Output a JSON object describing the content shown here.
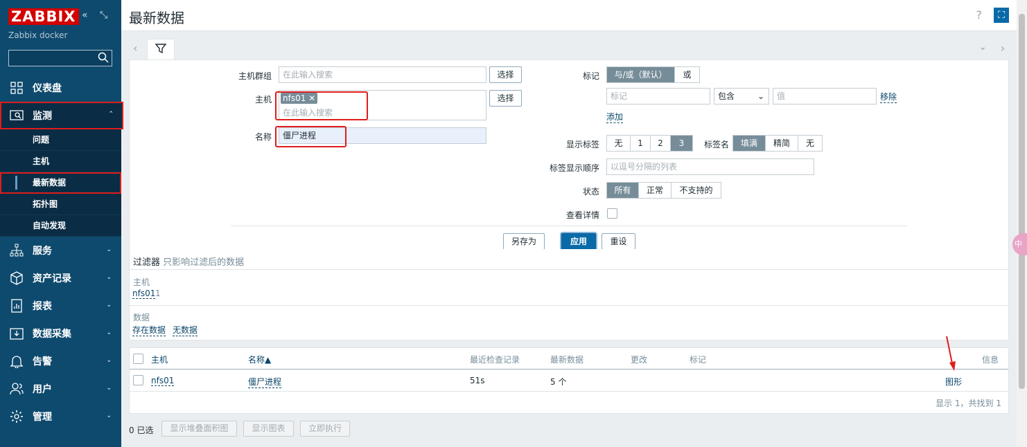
{
  "sidebar": {
    "logo": "ZABBIX",
    "server": "Zabbix docker",
    "menu": [
      {
        "label": "仪表盘"
      },
      {
        "label": "监测"
      },
      {
        "label": "服务"
      },
      {
        "label": "资产记录"
      },
      {
        "label": "报表"
      },
      {
        "label": "数据采集"
      },
      {
        "label": "告警"
      },
      {
        "label": "用户"
      },
      {
        "label": "管理"
      }
    ],
    "submenu": [
      "问题",
      "主机",
      "最新数据",
      "拓扑图",
      "自动发现"
    ]
  },
  "header": {
    "title": "最新数据",
    "help": "?"
  },
  "filter": {
    "host_group_label": "主机群组",
    "host_group_placeholder": "在此输入搜索",
    "select": "选择",
    "host_label": "主机",
    "host_tag": "nfs01",
    "host_placeholder": "在此输入搜索",
    "name_label": "名称",
    "name_value": "僵尸进程",
    "tags_label": "标记",
    "tag_mode": [
      "与/或（默认）",
      "或"
    ],
    "tag_placeholder": "标记",
    "tag_operator": "包含",
    "value_placeholder": "值",
    "remove": "移除",
    "add": "添加",
    "show_tags_label": "显示标签",
    "show_tags": [
      "无",
      "1",
      "2",
      "3"
    ],
    "tag_name_label": "标签名",
    "tag_name_modes": [
      "填满",
      "精简",
      "无"
    ],
    "tag_order_label": "标签显示顺序",
    "tag_order_placeholder": "以逗号分隔的列表",
    "state_label": "状态",
    "states": [
      "所有",
      "正常",
      "不支持的"
    ],
    "details_label": "查看详情",
    "save_as": "另存为",
    "apply": "应用",
    "reset": "重设"
  },
  "summary": {
    "title": "过滤器",
    "subtitle": "只影响过滤后的数据",
    "host_heading": "主机",
    "host_name": "nfs01",
    "host_count": "1",
    "data_heading": "数据",
    "with_data": "存在数据",
    "without_data": "无数据"
  },
  "table": {
    "headers": {
      "host": "主机",
      "name": "名称",
      "last_check": "最近检查记录",
      "last_value": "最新数据",
      "change": "更改",
      "tags": "标记",
      "info": "信息"
    },
    "sort_arrow": "▲",
    "rows": [
      {
        "host": "nfs01",
        "name": "僵尸进程",
        "last_check": "51s",
        "last_value": "5 个",
        "action": "图形"
      }
    ],
    "footer": "显示 1，共找到 1"
  },
  "bottom": {
    "selected": "0 已选",
    "stacked": "显示堆叠面积图",
    "graph": "显示图表",
    "execute": "立即执行"
  },
  "ime": "中"
}
